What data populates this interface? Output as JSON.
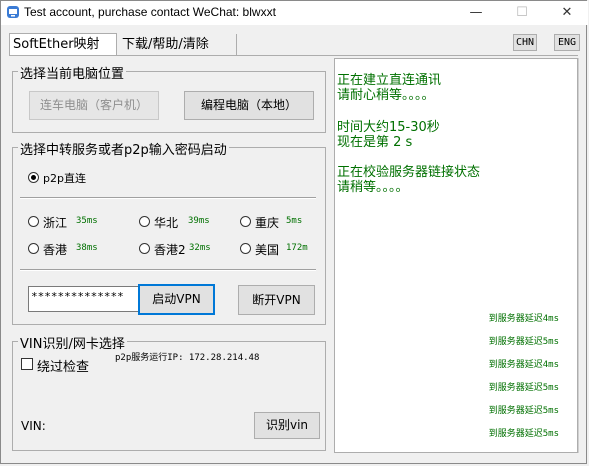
{
  "window": {
    "title": "Test account, purchase contact WeChat: blwxxt",
    "minimize": "—",
    "maximize": "☐",
    "close": "✕"
  },
  "tabs": [
    {
      "label": "SoftEther映射"
    },
    {
      "label": "下载/帮助/清除"
    }
  ],
  "lang": {
    "chn": "CHN",
    "eng": "ENG"
  },
  "location": {
    "title": "选择当前电脑位置",
    "client_button": "连车电脑（客户机）",
    "local_button": "编程电脑（本地）"
  },
  "relay": {
    "title": "选择中转服务或者p2p输入密码启动",
    "p2p_label": "p2p直连",
    "servers": [
      {
        "name": "浙江",
        "latency": "35ms"
      },
      {
        "name": "华北",
        "latency": "39ms"
      },
      {
        "name": "重庆",
        "latency": "5ms"
      },
      {
        "name": "香港",
        "latency": "38ms"
      },
      {
        "name": "香港2",
        "latency": "32ms"
      },
      {
        "name": "美国",
        "latency": "172m"
      }
    ],
    "password": "**************",
    "start_button": "启动VPN",
    "stop_button": "断开VPN"
  },
  "vin": {
    "title": "VIN识别/网卡选择",
    "skip_check": "绕过检查",
    "p2p_ip_text": "p2p服务运行IP: 172.28.214.48",
    "vin_label": "VIN:",
    "identify_button": "识别vin"
  },
  "log": {
    "lines": [
      "正在建立直连通讯",
      "请耐心稍等。。。。",
      "",
      "时间大约15-30秒",
      "现在是第 2 s",
      "",
      "正在校验服务器链接状态",
      "请稍等。。。。"
    ],
    "delays": [
      "到服务器延迟4ms",
      "到服务器延迟5ms",
      "到服务器延迟4ms",
      "到服务器延迟5ms",
      "到服务器延迟5ms",
      "到服务器延迟5ms"
    ]
  },
  "colors": {
    "log_text": "#007000",
    "focus_border": "#0078d7"
  }
}
